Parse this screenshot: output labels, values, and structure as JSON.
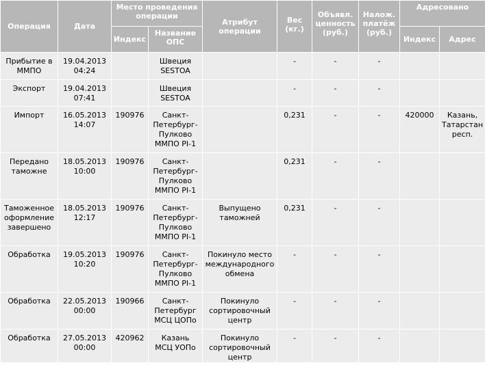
{
  "header": {
    "operation": "Операция",
    "date": "Дата",
    "place_group": "Место проведения операции",
    "place_index": "Индекс",
    "place_name": "Название ОПС",
    "attribute": "Атрибут операции",
    "weight": "Вес (кг.)",
    "declared_value": "Объявл. ценность (руб.)",
    "cod": "Налож. платёж (руб.)",
    "addressed_group": "Адресовано",
    "addr_index": "Индекс",
    "addr_address": "Адрес"
  },
  "rows": [
    {
      "operation": "Прибытие в ММПО",
      "date": "19.04.2013\n04:24",
      "index": "",
      "ops": "Швеция\nSESTOA",
      "attribute": "",
      "weight": "-",
      "value": "-",
      "cod": "-",
      "addr_index": "",
      "address": ""
    },
    {
      "operation": "Экспорт",
      "date": "19.04.2013\n07:41",
      "index": "",
      "ops": "Швеция\nSESTOA",
      "attribute": "",
      "weight": "-",
      "value": "-",
      "cod": "-",
      "addr_index": "",
      "address": ""
    },
    {
      "operation": "Импорт",
      "date": "16.05.2013\n14:07",
      "index": "190976",
      "ops": "Санкт-\nПетербург-\nПулково\nММПО PI-1",
      "attribute": "",
      "weight": "0,231",
      "value": "-",
      "cod": "-",
      "addr_index": "420000",
      "address": "Казань,\nТатарстан\nресп."
    },
    {
      "operation": "Передано таможне",
      "date": "18.05.2013\n10:00",
      "index": "190976",
      "ops": "Санкт-\nПетербург-\nПулково\nММПО PI-1",
      "attribute": "",
      "weight": "0,231",
      "value": "-",
      "cod": "-",
      "addr_index": "",
      "address": ""
    },
    {
      "operation": "Таможенное оформление завершено",
      "date": "18.05.2013\n12:17",
      "index": "190976",
      "ops": "Санкт-\nПетербург-\nПулково\nММПО PI-1",
      "attribute": "Выпущено\nтаможней",
      "weight": "0,231",
      "value": "-",
      "cod": "-",
      "addr_index": "",
      "address": ""
    },
    {
      "operation": "Обработка",
      "date": "19.05.2013\n10:20",
      "index": "190976",
      "ops": "Санкт-\nПетербург-\nПулково\nММПО PI-1",
      "attribute": "Покинуло место\nмеждународного\nобмена",
      "weight": "-",
      "value": "-",
      "cod": "-",
      "addr_index": "",
      "address": ""
    },
    {
      "operation": "Обработка",
      "date": "22.05.2013\n00:00",
      "index": "190966",
      "ops": "Санкт-\nПетербург\nМСЦ ЦОПо",
      "attribute": "Покинуло\nсортировочный\nцентр",
      "weight": "-",
      "value": "-",
      "cod": "-",
      "addr_index": "",
      "address": ""
    },
    {
      "operation": "Обработка",
      "date": "27.05.2013\n00:00",
      "index": "420962",
      "ops": "Казань\nМСЦ УОПо",
      "attribute": "Покинуло\nсортировочный\nцентр",
      "weight": "-",
      "value": "-",
      "cod": "-",
      "addr_index": "",
      "address": ""
    }
  ]
}
